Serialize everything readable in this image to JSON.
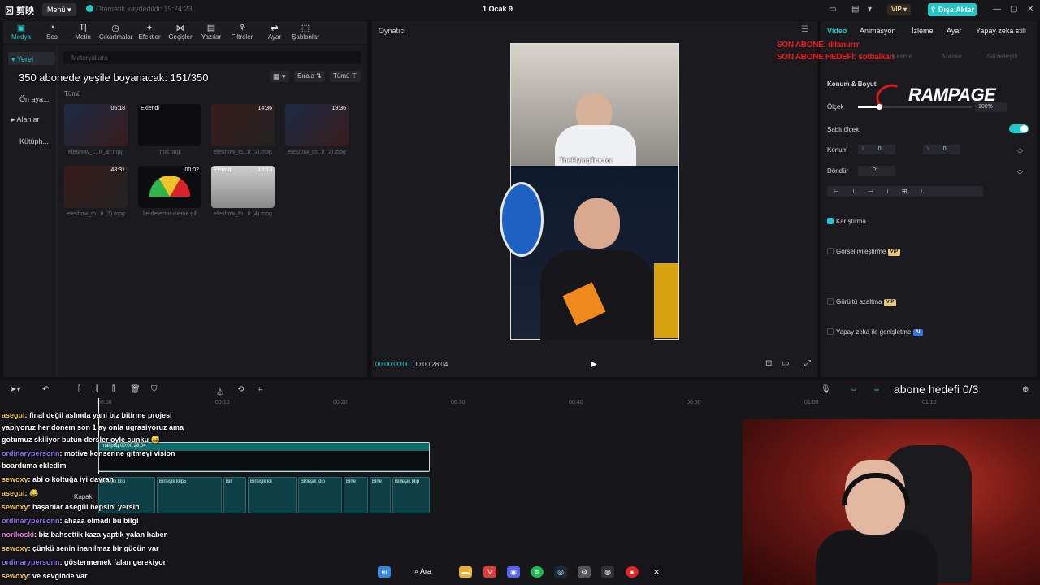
{
  "titlebar": {
    "logo": "⊠ 剪映",
    "menu": "Menü ▾",
    "autosave": "Otomatik kaydedildi: 19:24:23",
    "project": "1 Ocak 9",
    "vip": "VIP ▾",
    "export": "⇪ Dışa Aktar"
  },
  "toolbar": {
    "items": [
      {
        "label": "Medya",
        "icon": "▣"
      },
      {
        "label": "Ses",
        "icon": "◔"
      },
      {
        "label": "Metin",
        "icon": "T|"
      },
      {
        "label": "Çıkartmalar",
        "icon": "◷"
      },
      {
        "label": "Efektler",
        "icon": "✦"
      },
      {
        "label": "Geçişler",
        "icon": "⋈"
      },
      {
        "label": "Yazılar",
        "icon": "▤"
      },
      {
        "label": "Filtreler",
        "icon": "⚘"
      },
      {
        "label": "Ayar",
        "icon": "⇌"
      },
      {
        "label": "Şablonlar",
        "icon": "⬚"
      }
    ]
  },
  "media": {
    "side": [
      "▾ Yerel",
      "Ön aya...",
      "▸ Alanlar",
      "Kütüph..."
    ],
    "search_placeholder": "Materyal ara",
    "sort": "Sırala ⇅",
    "filter": "Tümü ⊤",
    "tumu": "Tümü",
    "items": [
      {
        "name": "efeshow_t...n_air.mpg",
        "duration": "05:18",
        "badge": ""
      },
      {
        "name": "mal.png",
        "duration": "",
        "badge": "Eklendi"
      },
      {
        "name": "efeshow_to...ir (1).mpg",
        "duration": "14:36",
        "badge": ""
      },
      {
        "name": "efeshow_to...ir (2).mpg",
        "duration": "19:36",
        "badge": ""
      },
      {
        "name": "efeshow_to...ir (3).mpg",
        "duration": "48:31",
        "badge": ""
      },
      {
        "name": "lie-detector-meme.gif",
        "duration": "00:02",
        "badge": ""
      },
      {
        "name": "efeshow_to...ir (4).mpg",
        "duration": "10:13",
        "badge": "Eklendi"
      }
    ]
  },
  "overlay": {
    "goal_text": "350 abonede yeşile boyanacak: 151/350",
    "abone_hedefi": "abone hedefi 0/3",
    "son_abone_1": "SON ABONE: dilanurrr",
    "son_abone_2": "SON ABONE HEDEFİ: sotbalkan"
  },
  "viewer": {
    "title": "Oynatıcı",
    "caption": "TheFlyingTractor",
    "current_time": "00:00:00:00",
    "total_time": "00:00:28:04"
  },
  "props": {
    "tabs": [
      "Video",
      "Animasyon",
      "İzleme",
      "Ayar",
      "Yapay zeka stili"
    ],
    "subtabs": [
      "Kesme",
      "Maske",
      "Güzelleştir"
    ],
    "konum_boyut": "Konum & Boyut",
    "olcek": "Ölçek",
    "olcek_value": "100%",
    "sabit_olcek": "Sabit ölçek",
    "konum": "Konum",
    "x_label": "X",
    "x_value": "0",
    "y_label": "Y",
    "y_value": "0",
    "dondur": "Döndür",
    "dondur_value": "0°",
    "karistirma": "Karıştırma",
    "gorsel": "Görsel iyileştirme",
    "gurultu": "Gürültü azaltma",
    "yapay": "Yapay zeka ile genişletme",
    "vip_badge": "VIP",
    "ai_badge": "AI",
    "rampage": "RAMPAGE"
  },
  "timeline": {
    "ruler": [
      "00:00",
      "00:10",
      "00:20",
      "00:30",
      "00:40",
      "00:50",
      "01:00",
      "01:10"
    ],
    "clip_label": "mal.png  00:00:28:04",
    "cover": "Kapak",
    "clips": [
      "Birleşik klip",
      "Birleşik klip5",
      "Bir",
      "Birleşik kli",
      "Birleşik klip",
      "Birle",
      "Birle",
      "Birleşik klip"
    ]
  },
  "chat": [
    {
      "user": "asegul",
      "color": "y",
      "text": ": final değil aslında yani biz bitirme projesi"
    },
    {
      "user": "",
      "color": "",
      "text": "yapiyoruz her donem son 1 ay onla ugrasiyoruz ama"
    },
    {
      "user": "",
      "color": "",
      "text": "gotumuz skiliyor butun dersler oyle cunku 😅"
    },
    {
      "user": "ordinarypersonn",
      "color": "",
      "text": ": motive konserine gitmeyi vision"
    },
    {
      "user": "",
      "color": "",
      "text": "boarduma ekledim"
    },
    {
      "user": "sewoxy",
      "color": "y",
      "text": ": abi o koltuğa iyi dayran"
    },
    {
      "user": "asegul",
      "color": "y",
      "text": ": 😂"
    },
    {
      "user": "sewoxy",
      "color": "y",
      "text": ": başarılar asegül hepsini yersin"
    },
    {
      "user": "ordinarypersonn",
      "color": "",
      "text": ": ahaaa olmadı bu bilgi"
    },
    {
      "user": "norikoski",
      "color": "p",
      "text": ": biz bahsettik kaza yaptık yalan haber"
    },
    {
      "user": "sewoxy",
      "color": "y",
      "text": ": çünkü senin inanılmaz bir gücün var"
    },
    {
      "user": "ordinarypersonn",
      "color": "",
      "text": ": göstermemek falan gerekiyor"
    },
    {
      "user": "sewoxy",
      "color": "y",
      "text": ": ve sevginde var"
    }
  ],
  "taskbar": {
    "search": "Ara"
  },
  "colors": {
    "accent": "#22c9cb",
    "background": "#1b1b1f",
    "webcam_red": "#b83324"
  }
}
